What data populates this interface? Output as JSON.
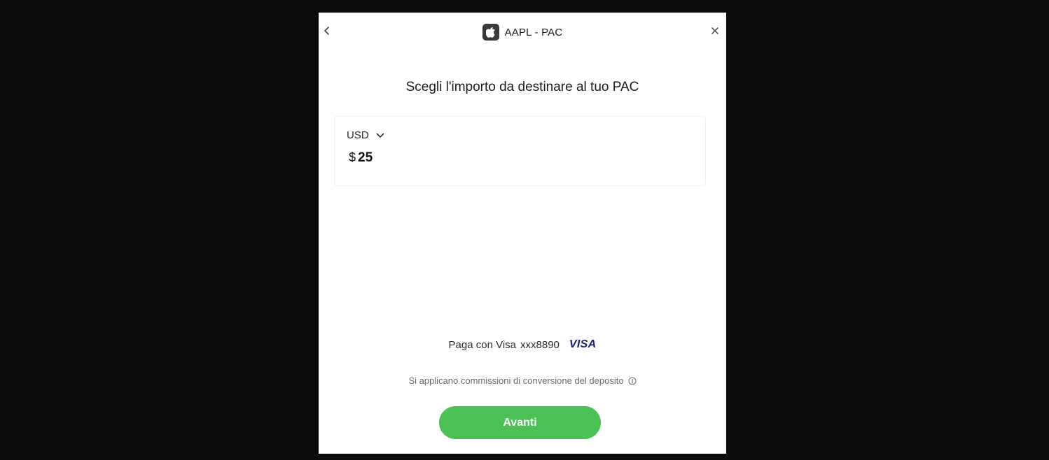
{
  "header": {
    "title": "AAPL - PAC",
    "logo_icon": "apple-icon",
    "back_icon": "chevron-left-icon",
    "close_icon": "close-icon"
  },
  "main": {
    "heading": "Scegli l'importo da destinare al tuo PAC",
    "amount_card": {
      "currency": "USD",
      "currency_icon": "chevron-down-icon",
      "symbol": "$",
      "value": "25"
    },
    "payment": {
      "label": "Paga con Visa",
      "card": "xxx8890",
      "brand": "VISA",
      "brand_color": "#1a1f71"
    },
    "fees_note": "Si applicano commissioni di conversione del deposito",
    "fees_icon": "info-icon",
    "next_button": "Avanti",
    "accent_color": "#4cbf55"
  }
}
